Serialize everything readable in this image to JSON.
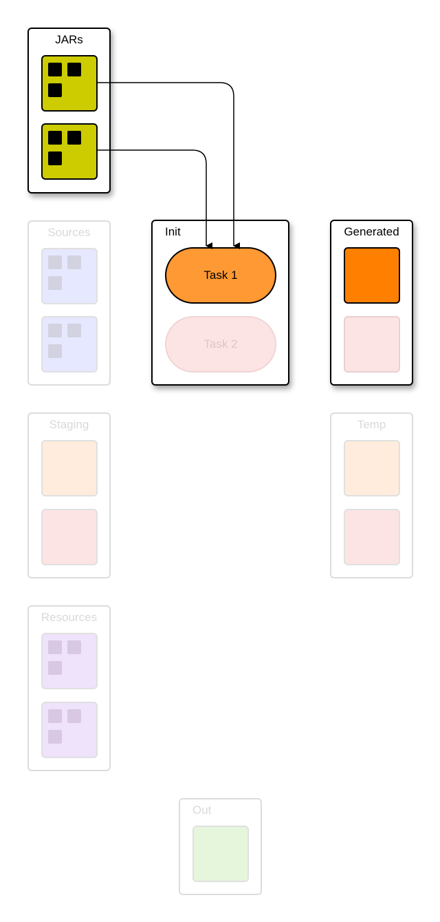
{
  "groups": {
    "jars": {
      "label": "JARs"
    },
    "sources": {
      "label": "Sources"
    },
    "init": {
      "label": "Init"
    },
    "generated": {
      "label": "Generated"
    },
    "staging": {
      "label": "Staging"
    },
    "temp": {
      "label": "Temp"
    },
    "resources": {
      "label": "Resources"
    },
    "out": {
      "label": "Out"
    }
  },
  "tasks": {
    "task1": "Task 1",
    "task2": "Task 2"
  },
  "colors": {
    "jar_tile": "#cccc00",
    "sources_tile": "#e6e8ff",
    "task1": "#ff9933",
    "task2": "#fde4e4",
    "generated_tile": "#ff8000",
    "pink_tile": "#fde4e4",
    "staging_tile": "#ffecdc",
    "resources_tile": "#efe2fb",
    "out_tile": "#e6f6dc"
  }
}
